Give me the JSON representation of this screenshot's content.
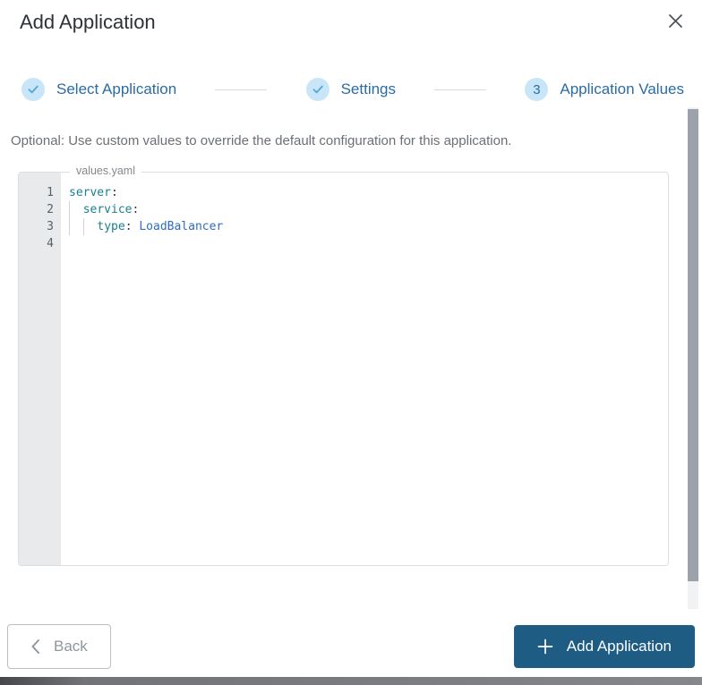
{
  "modal": {
    "title": "Add Application"
  },
  "icons": {
    "close": "close-x",
    "step_complete": "check",
    "back": "chevron-left",
    "add": "plus"
  },
  "stepper": {
    "steps": [
      {
        "label": "Select Application",
        "state": "complete",
        "indicator": "check"
      },
      {
        "label": "Settings",
        "state": "complete",
        "indicator": "check"
      },
      {
        "label": "Application Values",
        "state": "current",
        "indicator": "3"
      }
    ]
  },
  "content": {
    "description": "Optional: Use custom values to override the default configuration for this application.",
    "editor": {
      "filename_label": "values.yaml",
      "code_lines": [
        {
          "number": "1",
          "tokens": [
            {
              "t": "key",
              "v": "server"
            },
            {
              "t": "p",
              "v": ":"
            }
          ]
        },
        {
          "number": "2",
          "tokens": [
            {
              "t": "ind",
              "v": 1
            },
            {
              "t": "key",
              "v": "service"
            },
            {
              "t": "p",
              "v": ":"
            }
          ]
        },
        {
          "number": "3",
          "tokens": [
            {
              "t": "ind",
              "v": 2
            },
            {
              "t": "key",
              "v": "type"
            },
            {
              "t": "p",
              "v": ":"
            },
            {
              "t": "sp",
              "v": " "
            },
            {
              "t": "val",
              "v": "LoadBalancer"
            }
          ]
        },
        {
          "number": "4",
          "tokens": []
        }
      ]
    }
  },
  "footer": {
    "back_label": "Back",
    "add_label": "Add Application"
  },
  "colors": {
    "stepper_blue": "#2b6ba3",
    "step_circle_bg": "#c9e6f9",
    "check_blue": "#55a5da",
    "button_blue": "#1e5c84",
    "code_key_teal": "#1a7f8e",
    "code_value_blue": "#2f6cc2"
  }
}
